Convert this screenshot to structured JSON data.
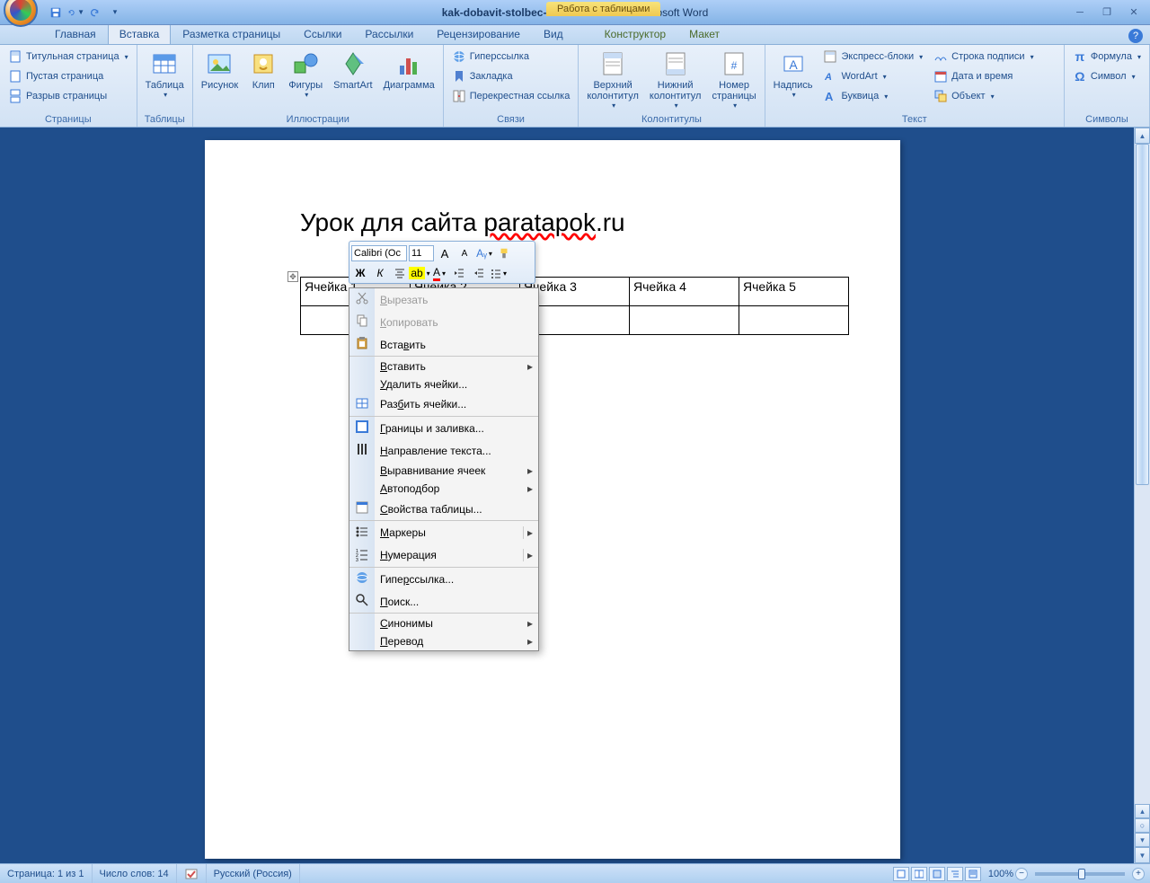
{
  "title": {
    "doc": "kak-dobavit-stolbec-v-tablicu-vord",
    "app": "Microsoft Word",
    "table_tools": "Работа с таблицами"
  },
  "tabs": [
    "Главная",
    "Вставка",
    "Разметка страницы",
    "Ссылки",
    "Рассылки",
    "Рецензирование",
    "Вид",
    "Конструктор",
    "Макет"
  ],
  "active_tab": 1,
  "ribbon": {
    "pages": {
      "label": "Страницы",
      "items": [
        "Титульная страница",
        "Пустая страница",
        "Разрыв страницы"
      ]
    },
    "tables": {
      "label": "Таблицы",
      "btn": "Таблица"
    },
    "illus": {
      "label": "Иллюстрации",
      "items": [
        "Рисунок",
        "Клип",
        "Фигуры",
        "SmartArt",
        "Диаграмма"
      ]
    },
    "links": {
      "label": "Связи",
      "items": [
        "Гиперссылка",
        "Закладка",
        "Перекрестная ссылка"
      ]
    },
    "hf": {
      "label": "Колонтитулы",
      "items": [
        "Верхний\nколонтитул",
        "Нижний\nколонтитул",
        "Номер\nстраницы"
      ]
    },
    "text": {
      "label": "Текст",
      "big": "Надпись",
      "items": [
        "Экспресс-блоки",
        "WordArt",
        "Буквица",
        "Строка подписи",
        "Дата и время",
        "Объект"
      ]
    },
    "symbols": {
      "label": "Символы",
      "items": [
        "Формула",
        "Символ"
      ]
    }
  },
  "document": {
    "heading_pre": "Урок для сайта ",
    "heading_wavy": "paratapok",
    "heading_post": ".ru",
    "table": {
      "r1": [
        "Ячейка 1",
        "Ячейка 2",
        "Ячейка 3",
        "Ячейка 4",
        "Ячейка 5"
      ],
      "r2": [
        "",
        "",
        "",
        "",
        ""
      ]
    }
  },
  "minitoolbar": {
    "font": "Calibri (Ос",
    "size": "11"
  },
  "context_menu": [
    {
      "icon": "cut",
      "label": "Вырезать",
      "disabled": true,
      "u": 0
    },
    {
      "icon": "copy",
      "label": "Копировать",
      "disabled": true,
      "u": 0
    },
    {
      "icon": "paste",
      "label": "Вставить",
      "u": 4
    },
    {
      "sep": true
    },
    {
      "label": "Вставить",
      "sub": true,
      "u": 0
    },
    {
      "label": "Удалить ячейки...",
      "u": 0
    },
    {
      "icon": "split",
      "label": "Разбить ячейки...",
      "u": 3
    },
    {
      "sep": true
    },
    {
      "icon": "borders",
      "label": "Границы и заливка...",
      "u": 0
    },
    {
      "icon": "textdir",
      "label": "Направление текста...",
      "u": 0
    },
    {
      "label": "Выравнивание ячеек",
      "sub": true,
      "u": 0
    },
    {
      "label": "Автоподбор",
      "sub": true,
      "u": 0
    },
    {
      "icon": "props",
      "label": "Свойства таблицы...",
      "u": 0
    },
    {
      "sep": true
    },
    {
      "icon": "bullets",
      "label": "Маркеры",
      "sub": true,
      "dd": true,
      "u": 0
    },
    {
      "icon": "numbers",
      "label": "Нумерация",
      "sub": true,
      "dd": true,
      "u": 0
    },
    {
      "sep": true
    },
    {
      "icon": "link",
      "label": "Гиперссылка...",
      "u": 4
    },
    {
      "icon": "find",
      "label": "Поиск...",
      "u": 0
    },
    {
      "sep": true
    },
    {
      "label": "Синонимы",
      "sub": true,
      "u": 0
    },
    {
      "label": "Перевод",
      "sub": true,
      "u": 0
    }
  ],
  "status": {
    "page": "Страница: 1 из 1",
    "words": "Число слов: 14",
    "lang": "Русский (Россия)",
    "zoom": "100%"
  }
}
